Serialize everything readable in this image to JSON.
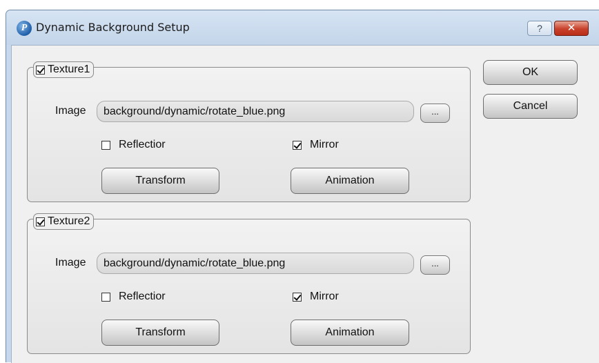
{
  "window": {
    "title": "Dynamic Background Setup",
    "help_label": "?",
    "close_label": "✕"
  },
  "buttons": {
    "ok": "OK",
    "cancel": "Cancel"
  },
  "textures": [
    {
      "label": "Texture1",
      "enabled": true,
      "image_label": "Image",
      "image_value": "background/dynamic/rotate_blue.png",
      "browse_label": "...",
      "reflection_label": "Reflectior",
      "reflection_checked": false,
      "mirror_label": "Mirror",
      "mirror_checked": true,
      "transform_label": "Transform",
      "animation_label": "Animation"
    },
    {
      "label": "Texture2",
      "enabled": true,
      "image_label": "Image",
      "image_value": "background/dynamic/rotate_blue.png",
      "browse_label": "...",
      "reflection_label": "Reflectior",
      "reflection_checked": false,
      "mirror_label": "Mirror",
      "mirror_checked": true,
      "transform_label": "Transform",
      "animation_label": "Animation"
    }
  ]
}
